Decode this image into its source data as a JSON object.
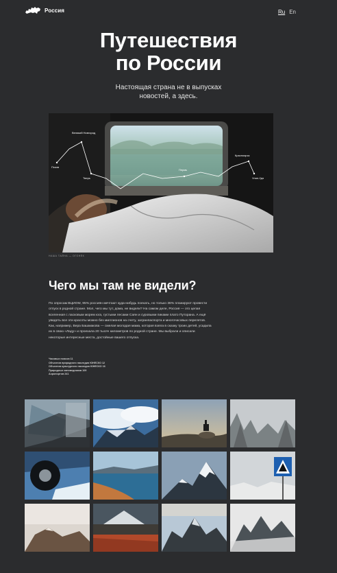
{
  "header": {
    "logo_text": "Россия",
    "lang_ru": "Ru",
    "lang_en": "En"
  },
  "hero": {
    "title_line1": "Путешествия",
    "title_line2": "по России",
    "subtitle": "Настоящая страна не в выпусках новостей, а здесь."
  },
  "photo": {
    "caption": "Наша Тайна — Огонёк",
    "route_labels": [
      "Великий Новгород",
      "Псков",
      "Тверь",
      "Пермь",
      "Красноярск",
      "Улан-Удэ"
    ]
  },
  "section": {
    "title": "Чего мы там не видели?",
    "text": "По опросам ВЦИОМ, 95% россиян мечтают куда-нибудь поехать, но только 36% планируют провести отпуск в родной стране. Мол, чего мы тут, дома, не видели? На самом деле, Россия — это целая вселенная с ласковым морем юга, густыми лесами Саян и суровыми пиками плато Путорана. А ещё увидеть все эти красоты можно без миллионов на счету, загранпаспорта и многочасовых перелетов. Как, например, Вера Башмакова — смелая молодая мама, которая взяла в сказку троих детей, усадила их в свою «Ладу» и проехала 20 тысяч километров по родной стране. Мы выбрали и описали некоторые интересные места, достойные вашего отпуска.",
    "stats": [
      "Часовых поясов 11",
      "Объектов природного наследия ЮНЕСКО 12",
      "Объектов культурного наследия ЮНЕСКО 16",
      "Природных заповедников 109",
      "Аэропортов 241"
    ]
  },
  "gallery": {
    "tiles": [
      "train-window-photo",
      "clouds-mountains-photo",
      "dog-on-hill-photo",
      "foggy-forest-photo",
      "car-wheel-photo",
      "lake-shore-photo",
      "snowy-peak-photo",
      "road-sign-photo",
      "volcano-fog-photo",
      "volcano-field-photo",
      "rocky-ridge-photo",
      "misty-peaks-photo"
    ]
  },
  "colors": {
    "background": "#2b2c2e",
    "text": "#ffffff"
  }
}
